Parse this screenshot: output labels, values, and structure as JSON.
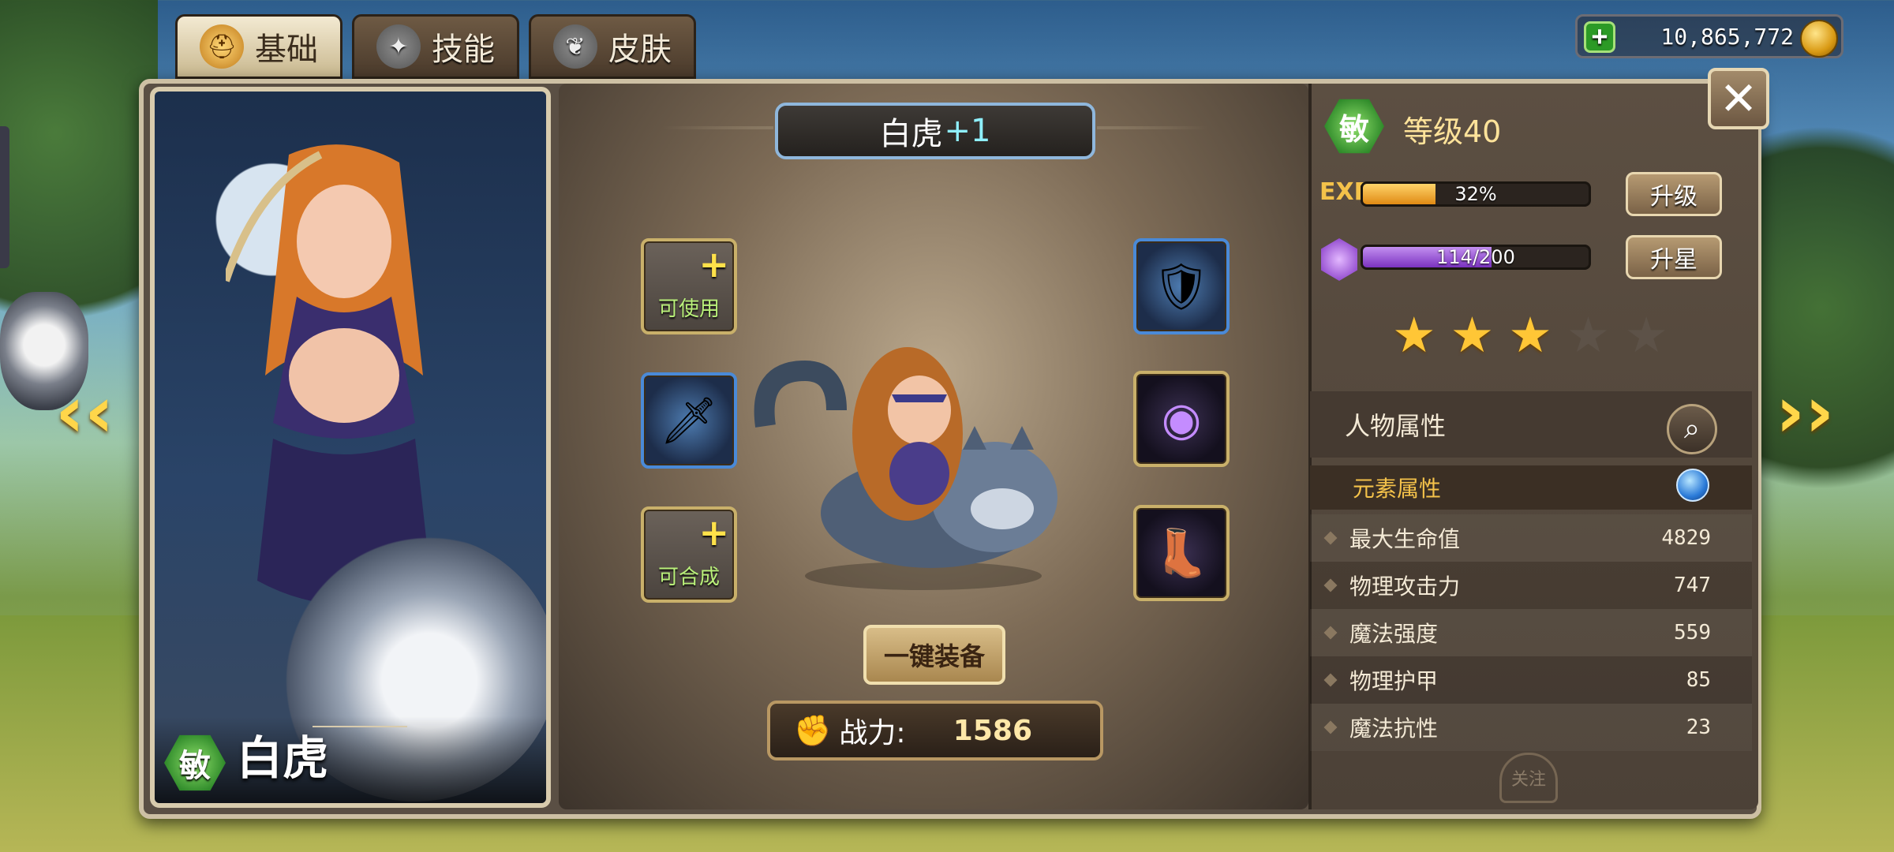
{
  "tabs": [
    {
      "label": "基础",
      "icon": "helmet-icon",
      "active": true
    },
    {
      "label": "技能",
      "icon": "skill-emblem-icon",
      "active": false
    },
    {
      "label": "皮肤",
      "icon": "mask-icon",
      "active": false
    }
  ],
  "currency": {
    "amount": "10,865,772",
    "icon": "gold-coin-stack-icon"
  },
  "hero": {
    "name": "白虎",
    "title_name": "白虎",
    "title_plus": "+1",
    "class_badge": "敏",
    "level_label": "等级40"
  },
  "equipment": {
    "slots": [
      {
        "id": "slot-1",
        "state": "empty",
        "label": "可使用"
      },
      {
        "id": "slot-2",
        "state": "filled",
        "item_icon": "chest-armor-icon"
      },
      {
        "id": "slot-3",
        "state": "filled",
        "item_icon": "dagger-icon"
      },
      {
        "id": "slot-4",
        "state": "filled",
        "item_icon": "dark-orb-icon"
      },
      {
        "id": "slot-5",
        "state": "empty",
        "label": "可合成"
      },
      {
        "id": "slot-6",
        "state": "filled",
        "item_icon": "boots-icon"
      }
    ],
    "equip_all_label": "一键装备",
    "power_label": "战力:",
    "power_value": "1586"
  },
  "progress": {
    "exp_label": "EXP",
    "exp_text": "32%",
    "exp_fraction": 0.32,
    "shard_text": "114/200",
    "shard_fraction": 0.57,
    "upgrade_label": "升级",
    "star_up_label": "升星"
  },
  "stars": {
    "filled": 3,
    "total": 5
  },
  "attributes": {
    "section_title": "人物属性",
    "element_label": "元素属性",
    "rows": [
      {
        "name": "最大生命值",
        "value": "4829"
      },
      {
        "name": "物理攻击力",
        "value": "747"
      },
      {
        "name": "魔法强度",
        "value": "559"
      },
      {
        "name": "物理护甲",
        "value": "85"
      },
      {
        "name": "魔法抗性",
        "value": "23"
      }
    ]
  },
  "follow_label": "关注",
  "colors": {
    "accent_gold": "#ffd64a",
    "exp": "#e08a14",
    "shard": "#7a32c0",
    "badge_green": "#2f8a2a"
  }
}
